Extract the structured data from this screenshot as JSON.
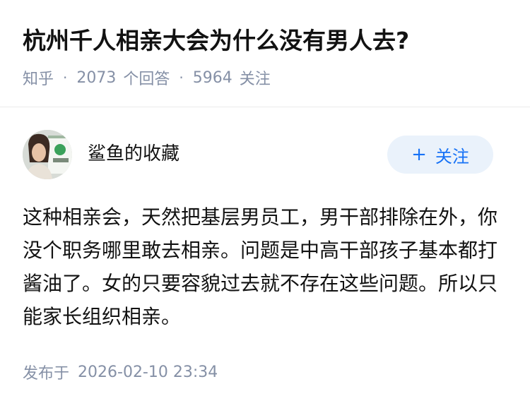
{
  "question": {
    "title": "杭州千人相亲大会为什么没有男人去?",
    "source": "知乎",
    "separator": "·",
    "answer_count": "2073",
    "answer_label": "个回答",
    "follower_count": "5964",
    "follower_label": "关注"
  },
  "answer": {
    "author": {
      "name": "鲨鱼的收藏",
      "avatar_icon": "user-avatar-photo"
    },
    "follow_button": {
      "icon": "plus-icon",
      "plus": "+",
      "label": "关注"
    },
    "content": "这种相亲会，天然把基层男员工，男干部排除在外，你没个职务哪里敢去相亲。问题是中高干部孩子基本都打酱油了。女的只要容貌过去就不存在这些问题。所以只能家长组织相亲。",
    "published_label": "发布于",
    "published_time": "2026-02-10 23:34"
  },
  "colors": {
    "text_primary": "#121212",
    "text_secondary": "#8590a6",
    "accent_blue": "#1772f6",
    "button_bg": "#eaf2fb",
    "divider": "#ebebeb"
  }
}
